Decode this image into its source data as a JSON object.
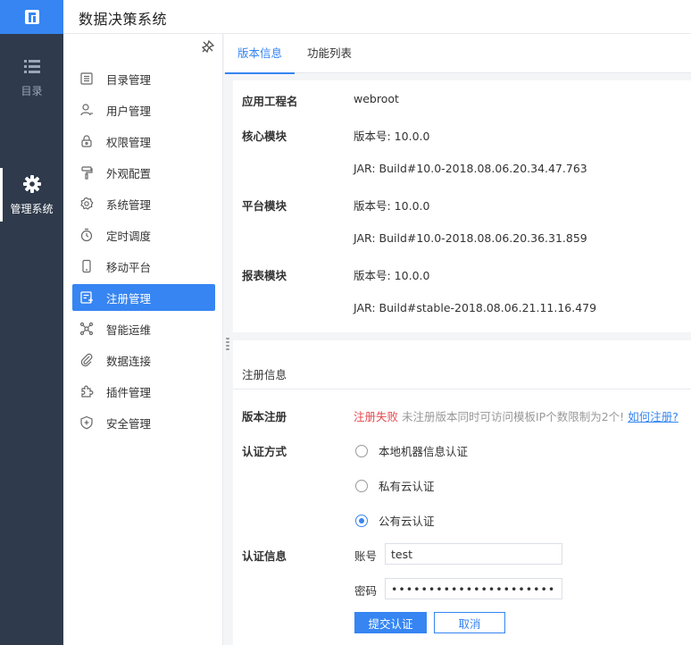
{
  "header": {
    "title": "数据决策系统"
  },
  "rail": {
    "items": [
      {
        "label": "目录",
        "icon": "list-icon",
        "active": false
      },
      {
        "label": "管理系统",
        "icon": "gear-icon",
        "active": true
      }
    ]
  },
  "menu": {
    "items": [
      {
        "label": "目录管理",
        "icon": "catalog-icon"
      },
      {
        "label": "用户管理",
        "icon": "user-icon"
      },
      {
        "label": "权限管理",
        "icon": "lock-icon"
      },
      {
        "label": "外观配置",
        "icon": "paint-roller-icon"
      },
      {
        "label": "系统管理",
        "icon": "settings-icon"
      },
      {
        "label": "定时调度",
        "icon": "timer-icon"
      },
      {
        "label": "移动平台",
        "icon": "mobile-icon"
      },
      {
        "label": "注册管理",
        "icon": "register-icon",
        "active": true
      },
      {
        "label": "智能运维",
        "icon": "network-icon"
      },
      {
        "label": "数据连接",
        "icon": "paperclip-icon"
      },
      {
        "label": "插件管理",
        "icon": "puzzle-icon"
      },
      {
        "label": "安全管理",
        "icon": "shield-icon"
      }
    ]
  },
  "tabs": [
    {
      "label": "版本信息",
      "active": true
    },
    {
      "label": "功能列表",
      "active": false
    }
  ],
  "version_info": {
    "app_name_label": "应用工程名",
    "app_name": "webroot",
    "core_label": "核心模块",
    "core_version": "版本号: 10.0.0",
    "core_jar": "JAR: Build#10.0-2018.08.06.20.34.47.763",
    "platform_label": "平台模块",
    "platform_version": "版本号: 10.0.0",
    "platform_jar": "JAR: Build#10.0-2018.08.06.20.36.31.859",
    "report_label": "报表模块",
    "report_version": "版本号: 10.0.0",
    "report_jar": "JAR: Build#stable-2018.08.06.21.11.16.479"
  },
  "registration": {
    "section_title": "注册信息",
    "version_reg_label": "版本注册",
    "status": "注册失败",
    "hint": "未注册版本同时可访问模板IP个数限制为2个!",
    "how_link": "如何注册?",
    "auth_method_label": "认证方式",
    "options": [
      "本地机器信息认证",
      "私有云认证",
      "公有云认证"
    ],
    "selected_option": 2,
    "auth_info_label": "认证信息",
    "account_label": "账号",
    "account_value": "test",
    "password_label": "密码",
    "password_value": "................................",
    "submit_label": "提交认证",
    "cancel_label": "取消"
  },
  "colors": {
    "accent": "#3685f2",
    "rail_bg": "#2f3b4c",
    "error": "#e5484d"
  }
}
